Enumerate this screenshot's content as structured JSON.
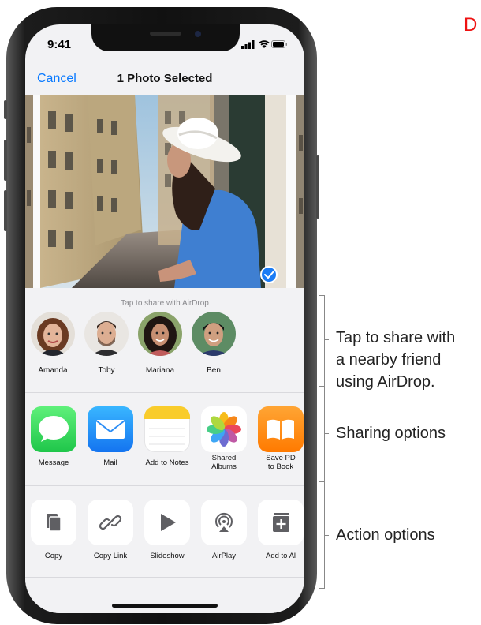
{
  "corner_letter": "D",
  "status": {
    "time": "9:41"
  },
  "nav": {
    "cancel": "Cancel",
    "title": "1 Photo Selected"
  },
  "airdrop": {
    "title": "Tap to share with AirDrop",
    "contacts": [
      "Amanda",
      "Toby",
      "Mariana",
      "Ben"
    ]
  },
  "share_apps": [
    {
      "label": "Message",
      "icon": "messages-icon"
    },
    {
      "label": "Mail",
      "icon": "mail-icon"
    },
    {
      "label": "Add to Notes",
      "icon": "notes-icon"
    },
    {
      "label": "Shared\nAlbums",
      "icon": "photos-icon"
    },
    {
      "label": "Save PD\nto Book",
      "icon": "books-icon"
    }
  ],
  "actions": [
    {
      "label": "Copy",
      "icon": "copy-icon"
    },
    {
      "label": "Copy Link",
      "icon": "link-icon"
    },
    {
      "label": "Slideshow",
      "icon": "play-icon"
    },
    {
      "label": "AirPlay",
      "icon": "airplay-icon"
    },
    {
      "label": "Add to Al",
      "icon": "add-album-icon"
    }
  ],
  "callouts": {
    "airdrop": "Tap to share with\na nearby friend\nusing AirDrop.",
    "sharing": "Sharing options",
    "action": "Action options"
  },
  "colors": {
    "link_blue": "#0a7aff",
    "sheet_bg": "#f2f2f4",
    "check_blue": "#1b7cf5"
  }
}
